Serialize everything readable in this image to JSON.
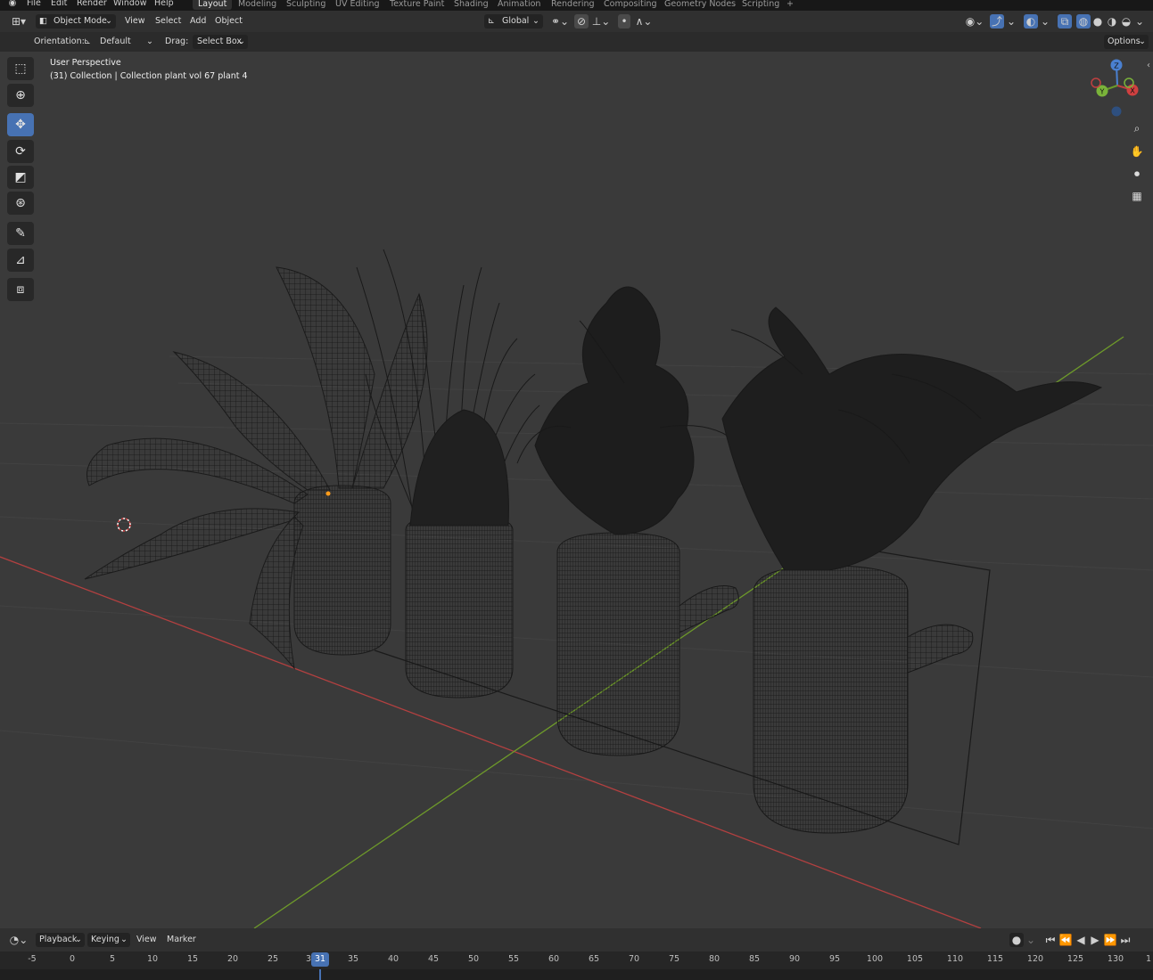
{
  "menubar": {
    "items": [
      "File",
      "Edit",
      "Render",
      "Window",
      "Help"
    ],
    "workspaces": [
      "Layout",
      "Modeling",
      "Sculpting",
      "UV Editing",
      "Texture Paint",
      "Shading",
      "Animation",
      "Rendering",
      "Compositing",
      "Geometry Nodes",
      "Scripting"
    ],
    "active_workspace": "Layout",
    "add_tab": "+"
  },
  "header": {
    "mode": "Object Mode",
    "menus": [
      "View",
      "Select",
      "Add",
      "Object"
    ],
    "transform_orientation": "Global",
    "options": "Options"
  },
  "tool_settings": {
    "orientation_label": "Orientation:",
    "orientation_value": "Default",
    "drag_label": "Drag:",
    "drag_value": "Select Box"
  },
  "viewport": {
    "perspective": "User Perspective",
    "collection_info": "(31) Collection | Collection plant vol 67 plant 4",
    "gizmo": {
      "z": "Z",
      "y": "Y",
      "x": "X"
    },
    "background_color": "#3a3a3a",
    "x_axis_color": "#b34040",
    "y_axis_color": "#6e9a2a"
  },
  "toolbar": {
    "tools": [
      "select-box",
      "cursor",
      "move",
      "rotate",
      "scale",
      "transform",
      "annotate",
      "measure",
      "add-cube"
    ],
    "active_tool": "move"
  },
  "navigation": [
    "zoom-icon",
    "hand-icon",
    "camera-icon",
    "grid-icon"
  ],
  "timeline": {
    "menus": [
      "Playback",
      "Keying",
      "View",
      "Marker"
    ],
    "current_frame": "31",
    "ticks": [
      "-5",
      "0",
      "5",
      "10",
      "15",
      "20",
      "25",
      "3",
      "35",
      "40",
      "45",
      "50",
      "55",
      "60",
      "65",
      "70",
      "75",
      "80",
      "85",
      "90",
      "95",
      "100",
      "105",
      "110",
      "115",
      "120",
      "125",
      "130",
      "1"
    ]
  },
  "colors": {
    "accent": "#4772b3",
    "header_bg": "#303030",
    "wire": "#141414"
  }
}
